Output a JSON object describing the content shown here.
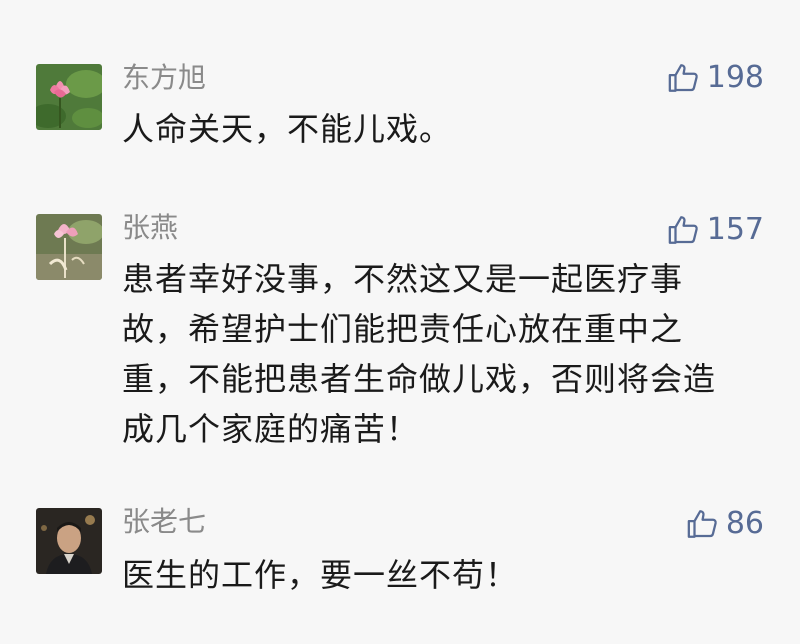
{
  "comments": [
    {
      "name": "东方旭",
      "likes": "198",
      "text": "人命关天，不能儿戏。",
      "avatar_icon": "lotus-avatar"
    },
    {
      "name": "张燕",
      "likes": "157",
      "text": "患者幸好没事，不然这又是一起医疗事故，希望护士们能把责任心放在重中之重，不能把患者生命做儿戏，否则将会造成几个家庭的痛苦！",
      "avatar_icon": "flower-avatar"
    },
    {
      "name": "张老七",
      "likes": "86",
      "text": "医生的工作，要一丝不苟！",
      "avatar_icon": "person-photo-avatar"
    }
  ],
  "colors": {
    "background": "#f7f7f7",
    "name": "#8a8a8a",
    "like": "#576b95",
    "text": "#1a1a1a"
  }
}
